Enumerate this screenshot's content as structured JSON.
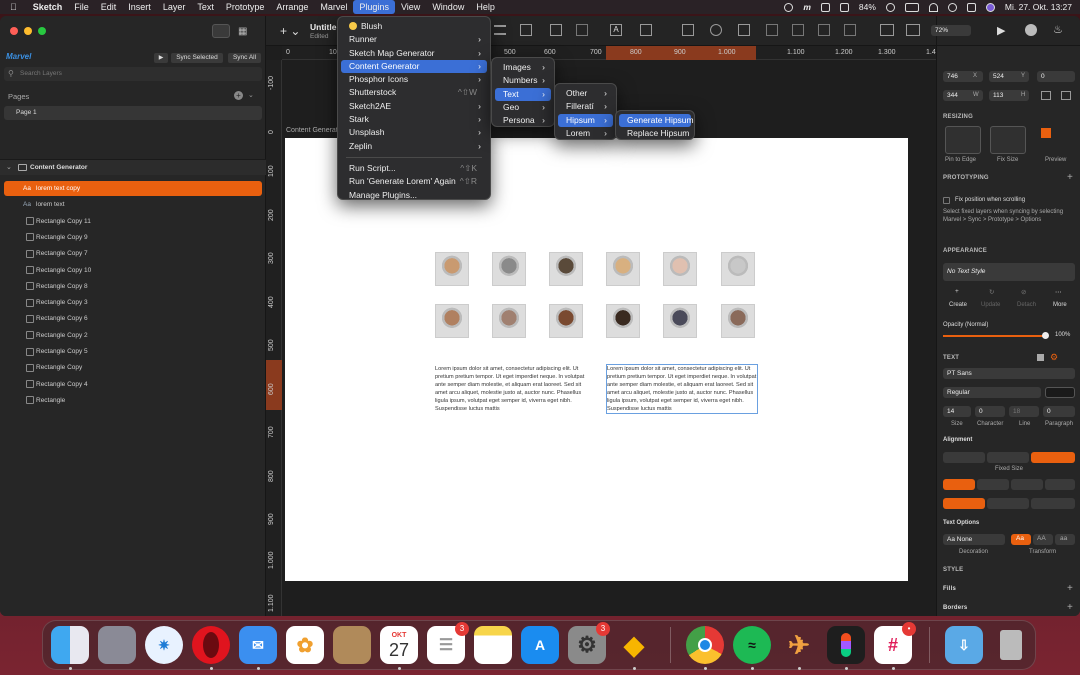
{
  "menubar": {
    "apple": "",
    "app": "Sketch",
    "items": [
      "File",
      "Edit",
      "Insert",
      "Layer",
      "Text",
      "Prototype",
      "Arrange",
      "Marvel",
      "Plugins",
      "View",
      "Window",
      "Help"
    ],
    "battery": "84%",
    "clock": "Mi. 27. Okt.  13:27"
  },
  "sidebar": {
    "marvel_logo": "Marvel",
    "sync_selected": "Sync Selected",
    "sync_all": "Sync All",
    "search_placeholder": "Search Layers",
    "pages_label": "Pages",
    "page1": "Page 1",
    "group": "Content Generator",
    "layers": [
      {
        "name": "lorem text copy",
        "type": "text"
      },
      {
        "name": "lorem text",
        "type": "text"
      },
      {
        "name": "Rectangle Copy 11",
        "type": "rect"
      },
      {
        "name": "Rectangle Copy 9",
        "type": "rect"
      },
      {
        "name": "Rectangle Copy 7",
        "type": "rect"
      },
      {
        "name": "Rectangle Copy 10",
        "type": "rect"
      },
      {
        "name": "Rectangle Copy 8",
        "type": "rect"
      },
      {
        "name": "Rectangle Copy 3",
        "type": "rect"
      },
      {
        "name": "Rectangle Copy 6",
        "type": "rect"
      },
      {
        "name": "Rectangle Copy 2",
        "type": "rect"
      },
      {
        "name": "Rectangle Copy 5",
        "type": "rect"
      },
      {
        "name": "Rectangle Copy",
        "type": "rect"
      },
      {
        "name": "Rectangle Copy 4",
        "type": "rect"
      },
      {
        "name": "Rectangle",
        "type": "rect"
      }
    ]
  },
  "document": {
    "title": "Untitle",
    "edited": "Edited"
  },
  "canvas": {
    "artboard_label": "Content Generator",
    "hruler_ticks": [
      "0",
      "10",
      "500",
      "600",
      "700",
      "800",
      "900",
      "1.000",
      "1.100",
      "1.200",
      "1.300",
      "1.400"
    ],
    "vruler_ticks": [
      "-100",
      "0",
      "100",
      "200",
      "300",
      "400",
      "500",
      "600",
      "700",
      "800",
      "900",
      "1.000",
      "1.100"
    ],
    "lorem": "Lorem ipsum dolor sit amet, consectetur adipiscing elit. Ut pretium pretium tempor. Ut eget imperdiet neque. In volutpat ante semper diam molestie, et aliquam erat laoreet. Sed sit amet arcu aliquet, molestie justo at, auctor nunc. Phasellus ligula ipsum, volutpat eget semper id, viverra eget nibh. Suspendisse luctus mattis"
  },
  "plugins_menu": {
    "items": [
      {
        "label": "Blush",
        "arrow": false
      },
      {
        "label": "Runner",
        "arrow": true
      },
      {
        "label": "Sketch Map Generator",
        "arrow": true
      },
      {
        "label": "Content Generator",
        "arrow": true,
        "highlight": true
      },
      {
        "label": "Phosphor Icons",
        "arrow": true
      },
      {
        "label": "Shutterstock",
        "shortcut": "^⇧W"
      },
      {
        "label": "Sketch2AE",
        "arrow": true
      },
      {
        "label": "Stark",
        "arrow": true
      },
      {
        "label": "Unsplash",
        "arrow": true
      },
      {
        "label": "Zeplin",
        "arrow": true
      }
    ],
    "run_script": "Run Script...",
    "run_script_sc": "^⇧K",
    "run_again": "Run 'Generate Lorem' Again",
    "run_again_sc": "^⇧R",
    "manage": "Manage Plugins..."
  },
  "cg_menu": [
    "Images",
    "Numbers",
    "Text",
    "Geo",
    "Persona"
  ],
  "text_menu": [
    "Other",
    "Filleratí",
    "Hipsum",
    "Lorem"
  ],
  "hipsum_menu": [
    "Generate Hipsum",
    "Replace Hipsum"
  ],
  "inspector": {
    "x": "746",
    "y": "524",
    "r": "0",
    "w": "344",
    "h": "113",
    "lbl_x": "X",
    "lbl_y": "Y",
    "lbl_w": "W",
    "lbl_h": "H",
    "resizing": "RESIZING",
    "pin": "Pin to Edge",
    "fix": "Fix Size",
    "preview": "Preview",
    "prototyping": "PROTOTYPING",
    "fix_pos": "Fix position when scrolling",
    "fix_desc": "Select fixed layers when syncing by selecting Marvel > Sync > Prototype > Options",
    "appearance": "APPEARANCE",
    "text_style": "No Text Style",
    "create": "Create",
    "update": "Update",
    "detach": "Detach",
    "more": "More",
    "opacity_label": "Opacity (Normal)",
    "opacity": "100%",
    "text_h": "TEXT",
    "font": "PT Sans",
    "weight": "Regular",
    "size": "14",
    "character": "0",
    "line": "18",
    "paragraph": "0",
    "lbl_size": "Size",
    "lbl_char": "Character",
    "lbl_line": "Line",
    "lbl_para": "Paragraph",
    "alignment": "Alignment",
    "fixed_size": "Fixed Size",
    "text_options": "Text Options",
    "decoration": "Aa None",
    "lbl_deco": "Decoration",
    "t_aa": "Aa",
    "t_AA": "AA",
    "t_aa2": "aa",
    "lbl_transform": "Transform",
    "style": "STYLE",
    "fills": "Fills",
    "borders": "Borders"
  },
  "dock": {
    "calendar_month": "OKT",
    "calendar_day": "27",
    "badges": {
      "reminders": "3",
      "settings": "3",
      "slack": "•"
    }
  },
  "toolbar": {
    "zoom": "72%"
  }
}
